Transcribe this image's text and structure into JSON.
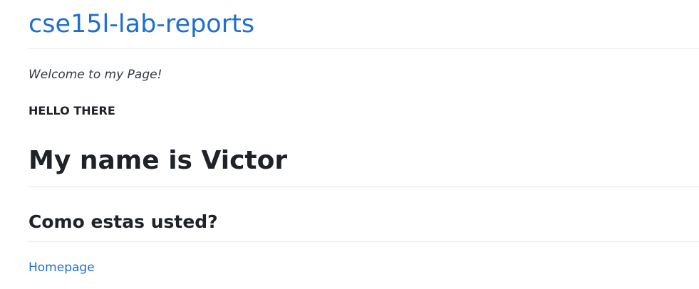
{
  "header": {
    "site_title": "cse15l-lab-reports"
  },
  "content": {
    "welcome_text": "Welcome to my Page!",
    "hello_text": "HELLO THERE",
    "heading_name": "My name is Victor",
    "heading_greeting": "Como estas usted?",
    "homepage_link": "Homepage"
  },
  "colors": {
    "link": "#1f6fcf",
    "text": "#1f2328",
    "rule": "#e4e8eb"
  }
}
